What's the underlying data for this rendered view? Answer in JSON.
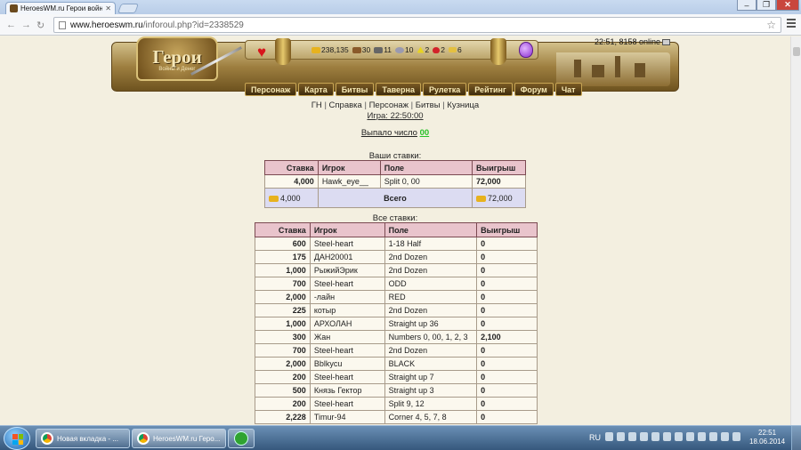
{
  "browser": {
    "tab_title": "HeroesWM.ru Герои войн",
    "url_host": "www.heroeswm.ru",
    "url_path": "/inforoul.php?id=2338529"
  },
  "header": {
    "logo_title": "Герои",
    "logo_subtitle": "Войны и Денег",
    "resources": [
      "238,135",
      "30",
      "11",
      "10",
      "2",
      "2",
      "6"
    ],
    "online": "22:51, 8158 online"
  },
  "menu": [
    "Персонаж",
    "Карта",
    "Битвы",
    "Таверна",
    "Рулетка",
    "Рейтинг",
    "Форум",
    "Чат"
  ],
  "sublinks": [
    "ГН",
    "Справка",
    "Персонаж",
    "Битвы",
    "Кузница"
  ],
  "game_time": "Игра: 22:50:00",
  "result": {
    "label": "Выпало число",
    "number": "00"
  },
  "your_bets": {
    "title": "Ваши ставки:",
    "headers": [
      "Ставка",
      "Игрок",
      "Поле",
      "Выигрыш"
    ],
    "rows": [
      {
        "stake": "4,000",
        "player": "Hawk_eye__",
        "field": "Split 0, 00",
        "win": "72,000"
      }
    ],
    "total": {
      "stake": "4,000",
      "label": "Всего",
      "win": "72,000"
    }
  },
  "all_bets": {
    "title": "Все ставки:",
    "headers": [
      "Ставка",
      "Игрок",
      "Поле",
      "Выигрыш"
    ],
    "rows": [
      {
        "stake": "600",
        "player": "Steel-heart",
        "field": "1-18 Half",
        "win": "0"
      },
      {
        "stake": "175",
        "player": "ДАН20001",
        "field": "2nd Dozen",
        "win": "0"
      },
      {
        "stake": "1,000",
        "player": "РыжийЭрик",
        "field": "2nd Dozen",
        "win": "0"
      },
      {
        "stake": "700",
        "player": "Steel-heart",
        "field": "ODD",
        "win": "0"
      },
      {
        "stake": "2,000",
        "player": "-лайн",
        "field": "RED",
        "win": "0"
      },
      {
        "stake": "225",
        "player": "котыр",
        "field": "2nd Dozen",
        "win": "0"
      },
      {
        "stake": "1,000",
        "player": "АРХОЛАН",
        "field": "Straight up 36",
        "win": "0"
      },
      {
        "stake": "300",
        "player": "Жан",
        "field": "Numbers 0, 00, 1, 2, 3",
        "win": "2,100"
      },
      {
        "stake": "700",
        "player": "Steel-heart",
        "field": "2nd Dozen",
        "win": "0"
      },
      {
        "stake": "2,000",
        "player": "Bblkycu",
        "field": "BLACK",
        "win": "0"
      },
      {
        "stake": "200",
        "player": "Steel-heart",
        "field": "Straight up 7",
        "win": "0"
      },
      {
        "stake": "500",
        "player": "Князь Гектор",
        "field": "Straight up 3",
        "win": "0"
      },
      {
        "stake": "200",
        "player": "Steel-heart",
        "field": "Split 9, 12",
        "win": "0"
      },
      {
        "stake": "2,228",
        "player": "Timur-94",
        "field": "Corner 4, 5, 7, 8",
        "win": "0"
      }
    ]
  },
  "taskbar": {
    "items": [
      "Новая вкладка - ...",
      "HeroesWM.ru Геро..."
    ],
    "lang": "RU",
    "time": "22:51",
    "date": "18.06.2014"
  }
}
